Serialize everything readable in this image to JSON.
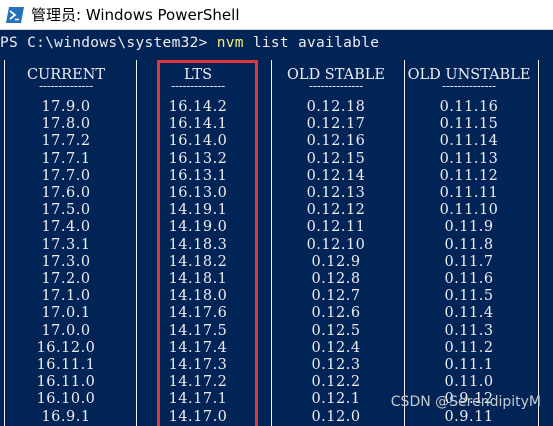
{
  "window": {
    "title": "管理员: Windows PowerShell",
    "icon": "powershell-icon"
  },
  "console": {
    "prompt": "PS C:\\windows\\system32>",
    "command": "nvm",
    "arguments": "list available"
  },
  "table": {
    "headers": [
      "CURRENT",
      "LTS",
      "OLD STABLE",
      "OLD UNSTABLE"
    ],
    "separator": "--------------",
    "rows": [
      [
        "17.9.0",
        "16.14.2",
        "0.12.18",
        "0.11.16"
      ],
      [
        "17.8.0",
        "16.14.1",
        "0.12.17",
        "0.11.15"
      ],
      [
        "17.7.2",
        "16.14.0",
        "0.12.16",
        "0.11.14"
      ],
      [
        "17.7.1",
        "16.13.2",
        "0.12.15",
        "0.11.13"
      ],
      [
        "17.7.0",
        "16.13.1",
        "0.12.14",
        "0.11.12"
      ],
      [
        "17.6.0",
        "16.13.0",
        "0.12.13",
        "0.11.11"
      ],
      [
        "17.5.0",
        "14.19.1",
        "0.12.12",
        "0.11.10"
      ],
      [
        "17.4.0",
        "14.19.0",
        "0.12.11",
        "0.11.9"
      ],
      [
        "17.3.1",
        "14.18.3",
        "0.12.10",
        "0.11.8"
      ],
      [
        "17.3.0",
        "14.18.2",
        "0.12.9",
        "0.11.7"
      ],
      [
        "17.2.0",
        "14.18.1",
        "0.12.8",
        "0.11.6"
      ],
      [
        "17.1.0",
        "14.18.0",
        "0.12.7",
        "0.11.5"
      ],
      [
        "17.0.1",
        "14.17.6",
        "0.12.6",
        "0.11.4"
      ],
      [
        "17.0.0",
        "14.17.5",
        "0.12.5",
        "0.11.3"
      ],
      [
        "16.12.0",
        "14.17.4",
        "0.12.4",
        "0.11.2"
      ],
      [
        "16.11.1",
        "14.17.3",
        "0.12.3",
        "0.11.1"
      ],
      [
        "16.11.0",
        "14.17.2",
        "0.12.2",
        "0.11.0"
      ],
      [
        "16.10.0",
        "14.17.1",
        "0.12.1",
        "0.9.12"
      ],
      [
        "16.9.1",
        "14.17.0",
        "0.12.0",
        "0.9.11"
      ]
    ]
  },
  "watermark": "CSDN @SerendipityM",
  "colors": {
    "console_bg": "#012456",
    "console_fg": "#eeedf0",
    "command_fg": "#f8f076",
    "highlight": "#e0383a"
  }
}
